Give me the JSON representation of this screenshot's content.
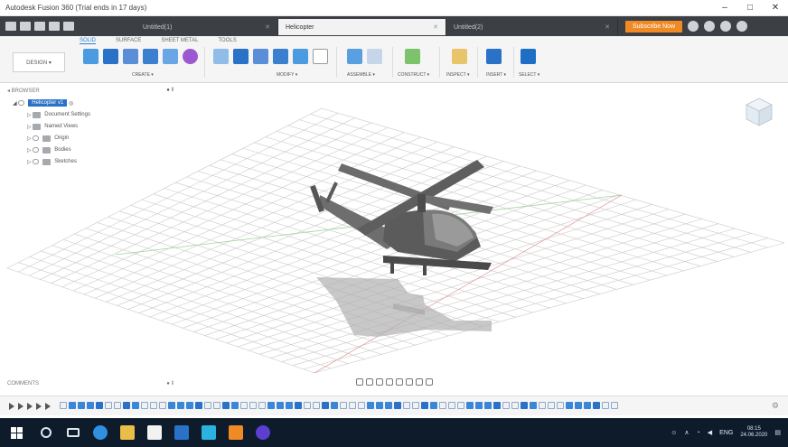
{
  "window": {
    "title": "Autodesk Fusion 360 (Trial ends in 17 days)",
    "controls": [
      "–",
      "□",
      "✕"
    ]
  },
  "tabs": [
    {
      "label": "Untitled(1)"
    },
    {
      "label": "Helicopter",
      "active": true
    },
    {
      "label": "Untitled(2)"
    }
  ],
  "trial_button": "Subscribe Now",
  "ribbon": {
    "tabs": [
      "SOLID",
      "SURFACE",
      "SHEET METAL",
      "TOOLS"
    ],
    "workspace": "DESIGN ▾",
    "groups": [
      "CREATE ▾",
      "MODIFY ▾",
      "ASSEMBLE ▾",
      "CONSTRUCT ▾",
      "INSPECT ▾",
      "INSERT ▾",
      "SELECT ▾"
    ]
  },
  "browser": {
    "header": "◂ BROWSER",
    "pin": "● ‖",
    "document": "Helicopter v1",
    "items": [
      "Document Settings",
      "Named Views",
      "Origin",
      "Bodies",
      "Sketches"
    ]
  },
  "comments": {
    "label": "COMMENTS",
    "toggle": "● ‖"
  },
  "icons": {
    "viewcube": "viewcube-icon",
    "search": "search-icon",
    "gear": "gear-icon",
    "play": "play-icon"
  },
  "colors": {
    "accent": "#2a7fd4",
    "trial": "#f08a24",
    "taskbar": "#0d1b2a",
    "canvas": "#ffffff",
    "grid": "#c9c9c9"
  },
  "taskbar": {
    "time": "08:15",
    "date": "24.06.2020",
    "lang": "ENG"
  }
}
